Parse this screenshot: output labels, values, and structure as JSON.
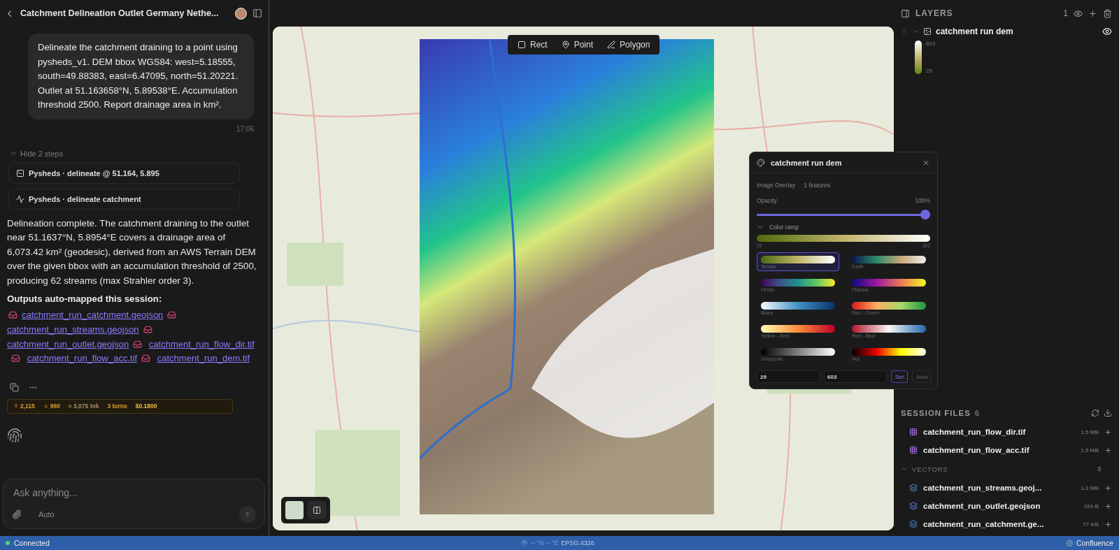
{
  "chat": {
    "title": "Catchment Delineation Outlet Germany Nethe...",
    "user_message": {
      "text": "Delineate the catchment draining to a point using pysheds_v1. DEM bbox WGS84: west=5.18555, south=49.88383, east=6.47095, north=51.20221. Outlet at 51.163658°N, 5.89538°E. Accumulation threshold 2500. Report drainage area in km².",
      "time": "17:06"
    },
    "steps_toggle": {
      "label": "Hide 2 steps",
      "expanded": true
    },
    "steps": [
      {
        "kind": "terminal",
        "label": "Pysheds · delineate @ 51.164, 5.895"
      },
      {
        "kind": "activity",
        "label": "Pysheds · delineate catchment"
      }
    ],
    "answer": "Delineation complete. The catchment draining to the outlet near 51.1637°N, 5.8954°E covers a drainage area of 6,073.42 km² (geodesic), derived from an AWS Terrain DEM over the given bbox with an accumulation threshold of 2500, producing 62 streams (max Strahler order 3).",
    "outputs_heading": "Outputs auto-mapped this session:",
    "outputs": [
      "catchment_run_catchment.geojson",
      "catchment_run_streams.geojson",
      "catchment_run_outlet.geojson",
      "catchment_run_flow_dir.tif",
      "catchment_run_flow_acc.tif",
      "catchment_run_dem.tif"
    ],
    "usage": {
      "input": "2,115",
      "output": "960",
      "total": "≈ 3,075 tok",
      "turns": "3 turns",
      "cost": "$0.1800"
    },
    "composer": {
      "placeholder": "Ask anything...",
      "mode": "Auto"
    }
  },
  "map": {
    "draw_tools": [
      "Rect",
      "Point",
      "Polygon"
    ]
  },
  "style_popup": {
    "title": "catchment run dem",
    "type": "Image Overlay",
    "features": "1 features",
    "opacity_label": "Opacity",
    "opacity_value": "100%",
    "opacity": {
      "level": 1
    },
    "ramp_toggle": {
      "label": "Color ramp",
      "expanded": true
    },
    "range_min": "29",
    "range_max": "603",
    "ramps": [
      {
        "kind": "terrain",
        "name": "Terrain",
        "selected": true
      },
      {
        "kind": "earth",
        "name": "Earth",
        "selected": false
      },
      {
        "kind": "viridis",
        "name": "Viridis",
        "selected": false
      },
      {
        "kind": "plasma",
        "name": "Plasma",
        "selected": false
      },
      {
        "kind": "blues",
        "name": "Blues",
        "selected": false
      },
      {
        "kind": "redgreen",
        "name": "Red→Green",
        "selected": false
      },
      {
        "kind": "yellowred",
        "name": "Yellow→Red",
        "selected": false
      },
      {
        "kind": "redblue",
        "name": "Red→Blue",
        "selected": false
      },
      {
        "kind": "grayscale",
        "name": "Grayscale",
        "selected": false
      },
      {
        "kind": "hot",
        "name": "Hot",
        "selected": false
      }
    ],
    "min_value": "29",
    "max_value": "603",
    "buttons": [
      "Set",
      "Auto"
    ]
  },
  "layers": {
    "title": "LAYERS",
    "count": "1",
    "items": [
      {
        "name": "catchment run dem",
        "visible": true,
        "legend_max": "603",
        "legend_min": "29"
      }
    ]
  },
  "session_files": {
    "title": "SESSION FILES",
    "count": "6",
    "items": [
      {
        "kind": "raster",
        "name": "catchment_run_flow_dir.tif",
        "size": "1.5 MB"
      },
      {
        "kind": "raster",
        "name": "catchment_run_flow_acc.tif",
        "size": "1.5 MB"
      }
    ],
    "groups": [
      {
        "name": "VECTORS",
        "count": "3",
        "expanded": true,
        "items": [
          {
            "kind": "vector",
            "name": "catchment_run_streams.geoj...",
            "size": "1.3 MB"
          },
          {
            "kind": "vector",
            "name": "catchment_run_outlet.geojson",
            "size": "193 B"
          },
          {
            "kind": "vector",
            "name": "catchment_run_catchment.ge...",
            "size": "77 KB"
          }
        ]
      }
    ]
  },
  "status_bar": {
    "connection": "Connected",
    "connected": true,
    "coordinates": "-- °N -- °E",
    "crs": "EPSG:4326",
    "app": "Confluence"
  }
}
